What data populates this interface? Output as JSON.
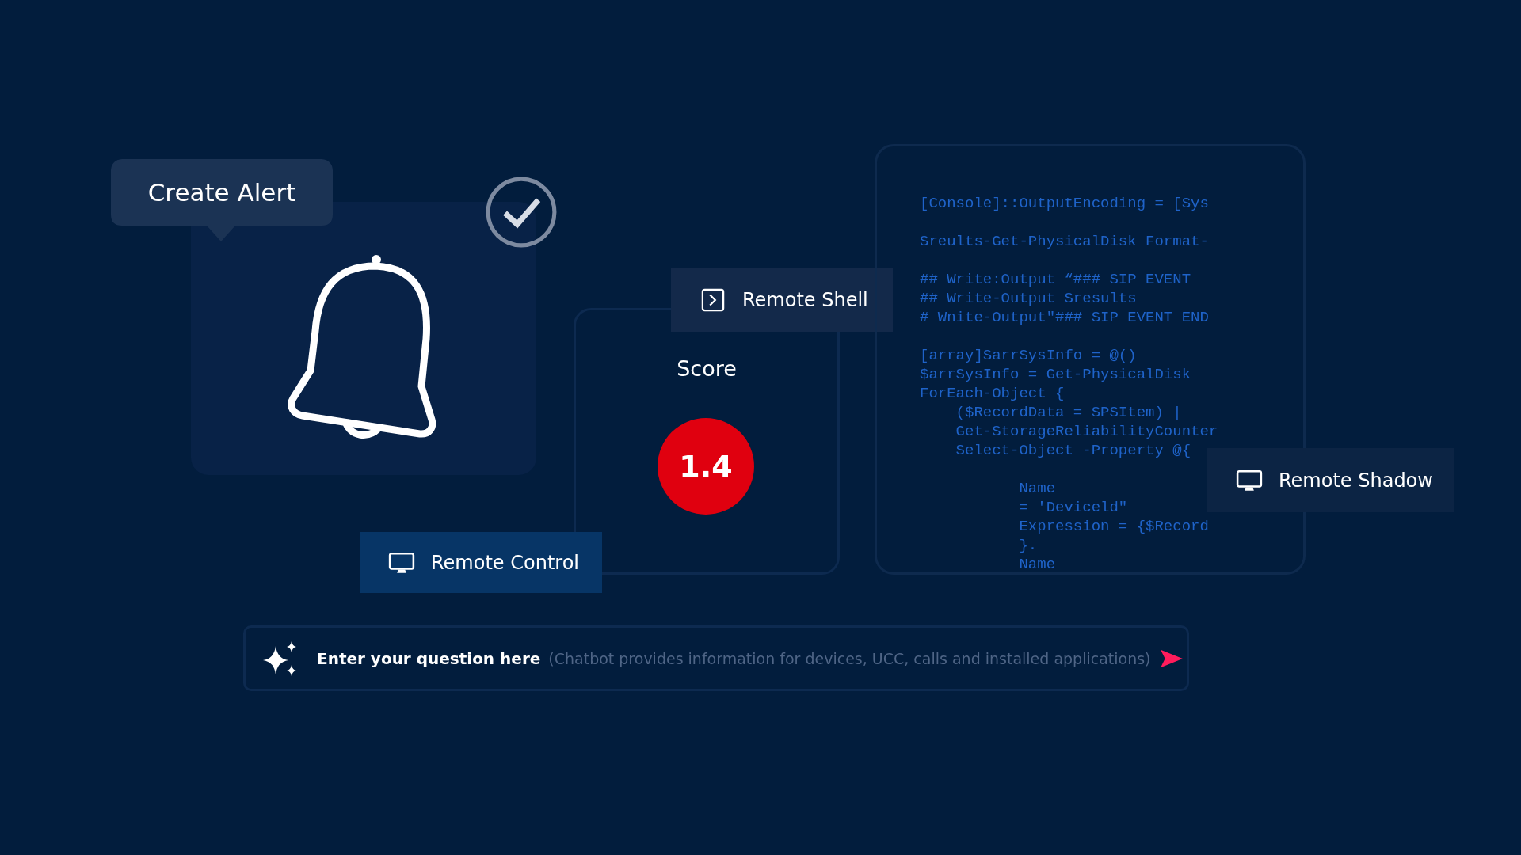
{
  "alert_card": {
    "tooltip": "Create Alert",
    "checked": true
  },
  "remote_shell": {
    "label": "Remote Shell"
  },
  "score_card": {
    "title": "Score",
    "value": "1.4",
    "color": "#e0000f"
  },
  "code_panel": {
    "blocks": [
      [
        "[Console]::OutputEncoding = [Sys"
      ],
      [
        "Sreults-Get-PhysicalDisk Format-"
      ],
      [
        "## Write:Output “### SIP EVENT",
        "## Write-Output Sresults",
        "# Wnite-Output\"### SIP EVENT END"
      ],
      [
        "[array]SarrSysInfo = @()",
        "$arrSysInfo = Get-PhysicalDisk",
        "ForEach-Object {",
        "    ($RecordData = SPSItem) |",
        "    Get-StorageReliabilityCounter",
        "    Select-Object -Property @{"
      ],
      [
        "           Name",
        "           = 'Deviceld\"",
        "           Expression = {$Record",
        "           }.",
        "           Name"
      ]
    ]
  },
  "remote_shadow": {
    "label": "Remote Shadow"
  },
  "remote_control": {
    "label": "Remote Control"
  },
  "chat": {
    "prompt": "Enter your question here",
    "placeholder": "(Chatbot provides information for devices, UCC, calls and installed applications)"
  }
}
